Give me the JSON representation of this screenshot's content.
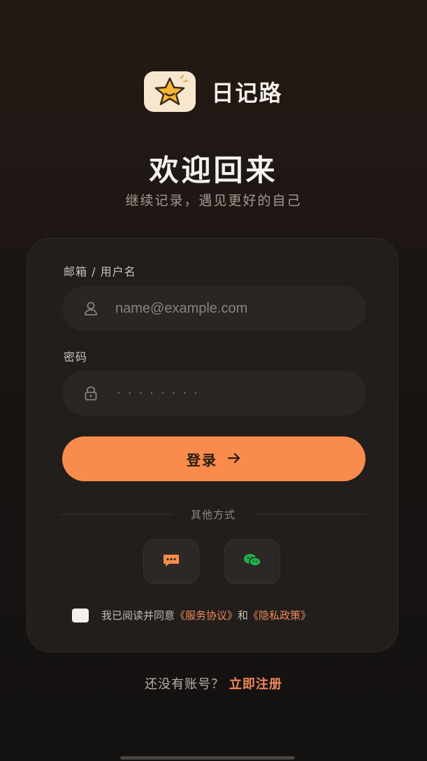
{
  "app": {
    "name": "日记路",
    "logo_icon": "star-icon"
  },
  "welcome": {
    "title": "欢迎回来",
    "subtitle": "继续记录，遇见更好的自己"
  },
  "form": {
    "username_label": "邮箱 / 用户名",
    "username_placeholder": "name@example.com",
    "password_label": "密码",
    "password_value": "········",
    "login_label": "登录",
    "login_icon": "arrow-right-icon"
  },
  "other": {
    "label": "其他方式",
    "methods": [
      {
        "name": "sms",
        "icon": "message-icon",
        "color": "#f98b4d"
      },
      {
        "name": "wechat",
        "icon": "wechat-icon",
        "color": "#1fb24a"
      }
    ]
  },
  "agreement": {
    "prefix": "我已阅读并同意",
    "terms": "《服务协议》",
    "and": "和",
    "privacy": "《隐私政策》"
  },
  "signup": {
    "prompt": "还没有账号？",
    "link": "立即注册"
  },
  "colors": {
    "accent": "#f98b4d",
    "background": "#1a1614",
    "card": "#221e1b"
  }
}
